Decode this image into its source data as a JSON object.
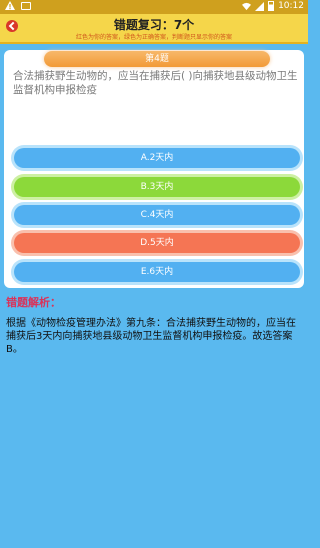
{
  "status_bar": {
    "time": "10:12"
  },
  "header": {
    "title": "错题复习：7个",
    "subtitle": "红色为你的答案，绿色为正确答案，判断题只显示你的答案"
  },
  "question": {
    "number": "第4题",
    "text": "合法捕获野生动物的，应当在捕获后( )向捕获地县级动物卫生监督机构申报检疫"
  },
  "options": [
    {
      "label": "A.2天内",
      "status": "normal",
      "color": "#52b0f1"
    },
    {
      "label": "B.3天内",
      "status": "correct",
      "color": "#8cd93a"
    },
    {
      "label": "C.4天内",
      "status": "normal",
      "color": "#52b0f1"
    },
    {
      "label": "D.5天内",
      "status": "selected-wrong",
      "color": "#f57554"
    },
    {
      "label": "E.6天内",
      "status": "normal",
      "color": "#52b0f1"
    }
  ],
  "analysis": {
    "label": "错题解析：",
    "text": "根据《动物检疫管理办法》第九条：合法捕获野生动物的，应当在捕获后3天内向捕获地县级动物卫生监督机构申报检疫。故选答案B。"
  }
}
